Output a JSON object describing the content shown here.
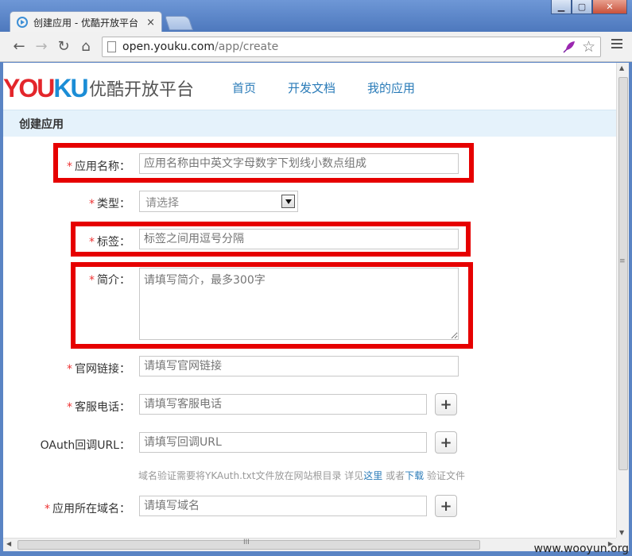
{
  "browser": {
    "tab_title": "创建应用 - 优酷开放平台",
    "tab_close": "×",
    "url_host": "open.youku.com",
    "url_path": "/app/create",
    "window_buttons": {
      "minimize": "▁",
      "maximize": "▢",
      "close": "✕"
    },
    "nav": {
      "back": "←",
      "forward": "→",
      "reload": "↻",
      "home": "⌂"
    },
    "star": "☆"
  },
  "header": {
    "logo_you": "YOU",
    "logo_ku": "KU",
    "platform_name": "优酷开放平台",
    "nav_items": [
      "首页",
      "开发文档",
      "我的应用"
    ]
  },
  "section": {
    "title": "创建应用"
  },
  "form": {
    "required_mark": "*",
    "app_name": {
      "label": "应用名称：",
      "placeholder": "应用名称由中英文字母数字下划线小数点组成"
    },
    "type": {
      "label": "类型：",
      "selected": "请选择"
    },
    "tags": {
      "label": "标签：",
      "placeholder": "标签之间用逗号分隔"
    },
    "intro": {
      "label": "简介：",
      "placeholder": "请填写简介，最多300字"
    },
    "website": {
      "label": "官网链接：",
      "placeholder": "请填写官网链接"
    },
    "phone": {
      "label": "客服电话：",
      "placeholder": "请填写客服电话"
    },
    "oauth": {
      "label": "OAuth回调URL：",
      "placeholder": "请填写回调URL"
    },
    "hint": {
      "text_before": "域名验证需要将YKAuth.txt文件放在网站根目录 详见",
      "link_here": "这里",
      "text_middle": " 或者",
      "link_download": "下载",
      "text_after": " 验证文件"
    },
    "domain": {
      "label": "应用所在域名：",
      "placeholder": "请填写域名"
    },
    "plus_label": "+"
  },
  "scrollbar": {
    "grip": "≡",
    "hgrip": "III"
  },
  "watermark": "www.wooyun.org",
  "colors": {
    "highlight_box": "#e60000",
    "link": "#2a7bb8",
    "section_bg": "#e5f2fb"
  }
}
